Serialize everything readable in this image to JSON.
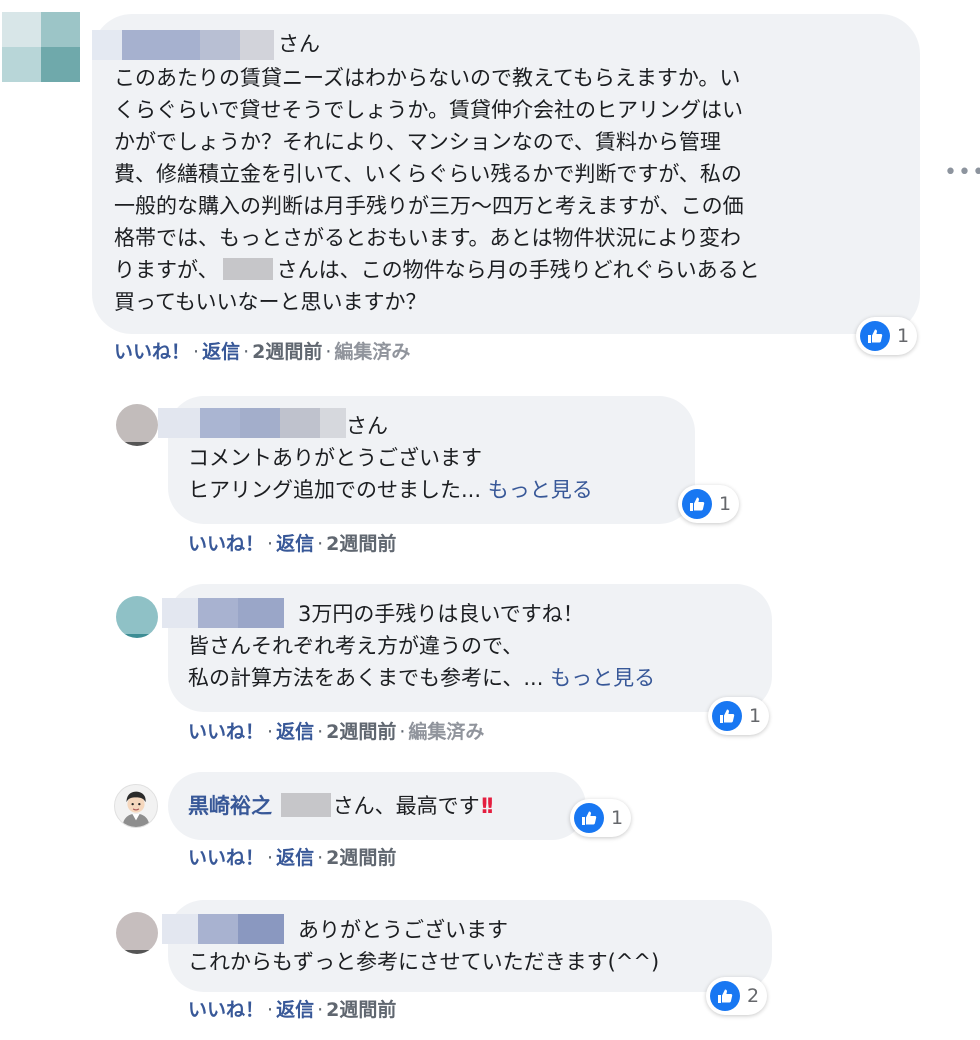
{
  "comments": [
    {
      "author_suffix": "さん",
      "lines": [
        "このあたりの賃貸ニーズはわからないので教えてもらえますか。い",
        "くらぐらいで貸せそうでしょうか。賃貸仲介会社のヒアリングはい",
        "かがでしょうか？それにより、マンションなので、賃料から管理",
        "費、修繕積立金を引いて、いくらぐらい残るかで判断ですが、私の",
        "一般的な購入の判断は月手残りが三万〜四万と考えますが、この価",
        "格帯では、もっとさがるとおもいます。あとは物件状況により変わ",
        "りますが、",
        "さんは、この物件なら月の手残りどれぐらいあると",
        "買ってもいいなーと思いますか？"
      ],
      "like": "いいね！",
      "reply": "返信",
      "time": "2週間前",
      "edited": "編集済み",
      "reaction_count": "1",
      "options_icon": "more-options-icon"
    },
    {
      "author_suffix": "さん",
      "lines": [
        "コメントありがとうございます",
        "ヒアリング追加でのせました..."
      ],
      "more_label": "もっと見る",
      "like": "いいね！",
      "reply": "返信",
      "time": "2週間前",
      "reaction_count": "1"
    },
    {
      "lines": [
        "3万円の手残りは良いですね！",
        "皆さんそれぞれ考え方が違うので、",
        "私の計算方法をあくまでも参考に、..."
      ],
      "more_label": "もっと見る",
      "like": "いいね！",
      "reply": "返信",
      "time": "2週間前",
      "edited": "編集済み",
      "reaction_count": "1"
    },
    {
      "author_name": "黒崎裕之",
      "text": "さん、最高です",
      "emoji": "!!",
      "like": "いいね！",
      "reply": "返信",
      "time": "2週間前",
      "reaction_count": "1"
    },
    {
      "lines": [
        "ありがとうございます",
        "これからもずっと参考にさせていただきます(^^)"
      ],
      "like": "いいね！",
      "reply": "返信",
      "time": "2週間前",
      "reaction_count": "2"
    }
  ],
  "separator": "·",
  "icons": {
    "like": "thumbs-up-icon",
    "options": "ellipsis-icon"
  },
  "colors": {
    "link": "#385898",
    "bubble": "#f0f2f5",
    "like_blue": "#1877f2"
  }
}
